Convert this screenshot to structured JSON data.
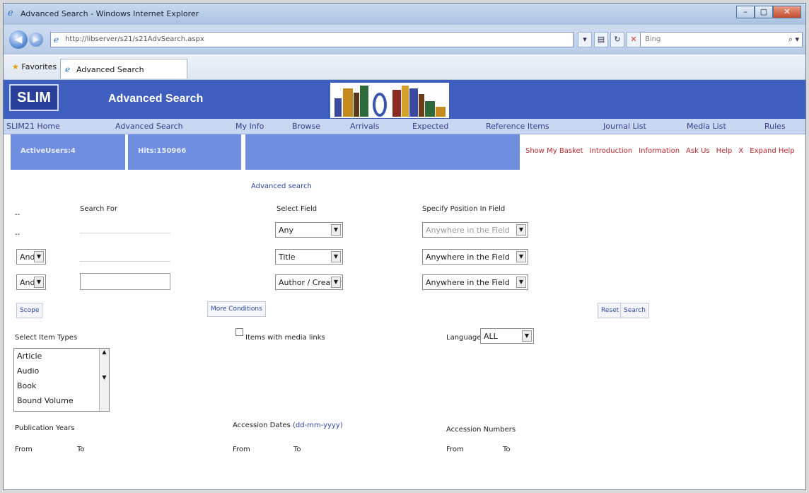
{
  "browser": {
    "window_title": "Advanced Search - Windows Internet Explorer",
    "url": "http://libserver/s21/s21AdvSearch.aspx",
    "search_placeholder": "Bing",
    "favorites_label": "Favorites",
    "tab_title": "Advanced Search",
    "controls": {
      "minimize": "–",
      "maximize": "▢",
      "close": "✕",
      "refresh": "↻",
      "stop": "✕",
      "back": "◀",
      "forward": "▶",
      "go": "⌕ ▾"
    }
  },
  "banner": {
    "logo": "SLIM",
    "page_title": "Advanced Search"
  },
  "menu": [
    "SLIM21 Home",
    "Advanced Search",
    "My Info",
    "Browse",
    "Arrivals",
    "Expected",
    "Reference Items",
    "Journal List",
    "Media List",
    "Rules"
  ],
  "status": {
    "active_users": "ActiveUsers:4",
    "hits": "Hits:150966",
    "links": [
      "Show My Basket",
      "Introduction",
      "Information",
      "Ask Us",
      "Help",
      "X",
      "Expand Help"
    ]
  },
  "form": {
    "heading_link": "Advanced search",
    "search_for_label": "Search For",
    "select_field_label": "Select Field",
    "position_label": "Specify Position In Field",
    "dash_1": "--",
    "dash_2": "--",
    "rows": [
      {
        "op": "",
        "field": "Any",
        "position": "Anywhere in the Field"
      },
      {
        "op": "And",
        "field": "Title",
        "position": "Anywhere in the Field"
      },
      {
        "op": "And",
        "field": "Author / Creator",
        "position": "Anywhere in the Field"
      }
    ],
    "scope_button": "Scope",
    "more_conditions_button": "More Conditions",
    "reset_button": "Reset",
    "search_button": "Search",
    "item_types_label": "Select Item Types",
    "item_types": [
      "Article",
      "Audio",
      "Book",
      "Bound Volume"
    ],
    "media_links_label": "Items with media links",
    "language_label": "Language",
    "language_value": "ALL",
    "publication_years_label": "Publication Years",
    "accession_dates_label": "Accession Dates",
    "accession_dates_format": "(dd-mm-yyyy)",
    "accession_numbers_label": "Accession Numbers",
    "from_label": "From",
    "to_label": "To"
  }
}
